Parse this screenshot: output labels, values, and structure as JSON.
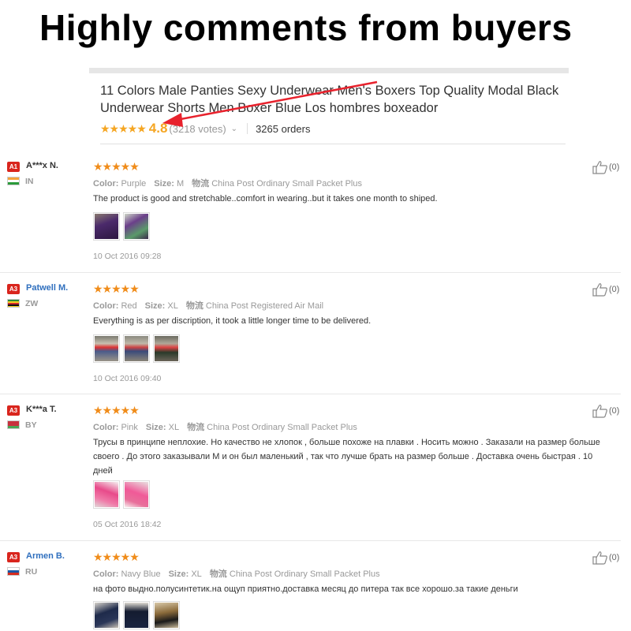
{
  "banner": {
    "title": "Highly comments from buyers"
  },
  "product": {
    "title": "11 Colors Male Panties Sexy Underwear Men's Boxers Top Quality Modal Black Underwear Shorts Men Boxer Blue Los hombres boxeador",
    "stars": "★★★★★",
    "rating": "4.8",
    "votes": "(3218 votes)",
    "orders": "3265 orders",
    "accent_color": "#f5a623"
  },
  "reviews": [
    {
      "rank": "A1",
      "name": "A***x N.",
      "country": "IN",
      "stars": "★★★★★",
      "color_label": "Color:",
      "color": "Purple",
      "size_label": "Size:",
      "size": "M",
      "shipping_label": "物流",
      "shipping": "China Post Ordinary Small Packet Plus",
      "text": "The product is good and stretchable..comfort in wearing..but it takes one month to shiped.",
      "date": "10 Oct 2016 09:28",
      "likes": "(0)"
    },
    {
      "rank": "A3",
      "name": "Patwell M.",
      "country": "ZW",
      "stars": "★★★★★",
      "color_label": "Color:",
      "color": "Red",
      "size_label": "Size:",
      "size": "XL",
      "shipping_label": "物流",
      "shipping": "China Post Registered Air Mail",
      "text": "Everything is as per discription, it took a little longer time to be delivered.",
      "date": "10 Oct 2016 09:40",
      "likes": "(0)"
    },
    {
      "rank": "A3",
      "name": "K***a T.",
      "country": "BY",
      "stars": "★★★★★",
      "color_label": "Color:",
      "color": "Pink",
      "size_label": "Size:",
      "size": "XL",
      "shipping_label": "物流",
      "shipping": "China Post Ordinary Small Packet Plus",
      "text": "Трусы в принципе неплохие. Но качество не хлопок , больше похоже на плавки . Носить можно . Заказали на размер больше своего . До этого заказывали М и он был маленький , так что лучше брать на размер больше . Доставка очень быстрая . 10 дней",
      "date": "05 Oct 2016 18:42",
      "likes": "(0)"
    },
    {
      "rank": "A3",
      "name": "Armen B.",
      "country": "RU",
      "stars": "★★★★★",
      "color_label": "Color:",
      "color": "Navy Blue",
      "size_label": "Size:",
      "size": "XL",
      "shipping_label": "物流",
      "shipping": "China Post Ordinary Small Packet Plus",
      "text": "на фото выдно.полусинтетик.на ощуп приятно.доставка месяц до питера так все хорошо.за такие деньги",
      "date": "",
      "likes": "(0)"
    }
  ]
}
